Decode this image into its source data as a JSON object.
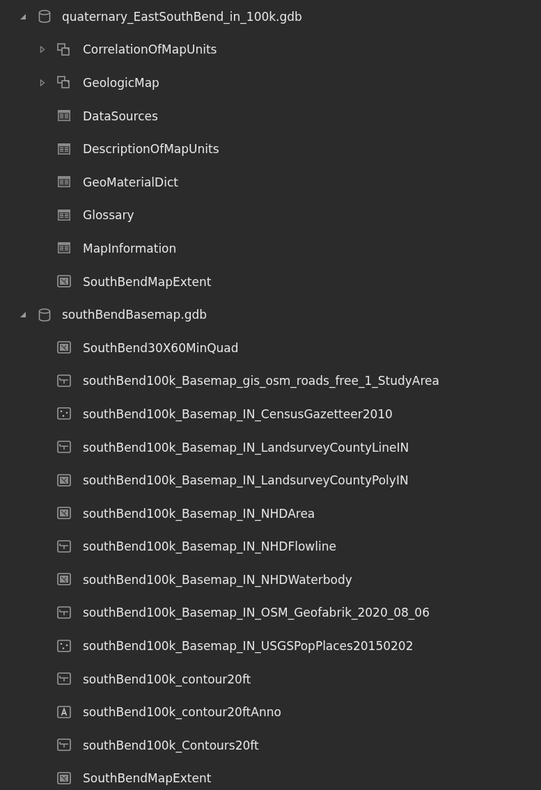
{
  "tree": [
    {
      "label": "quaternary_EastSouthBend_in_100k.gdb",
      "kind": "database",
      "expanded": true,
      "children": [
        {
          "label": "CorrelationOfMapUnits",
          "kind": "dataset",
          "expanded": false
        },
        {
          "label": "GeologicMap",
          "kind": "dataset",
          "expanded": false
        },
        {
          "label": "DataSources",
          "kind": "table"
        },
        {
          "label": "DescriptionOfMapUnits",
          "kind": "table"
        },
        {
          "label": "GeoMaterialDict",
          "kind": "table"
        },
        {
          "label": "Glossary",
          "kind": "table"
        },
        {
          "label": "MapInformation",
          "kind": "table"
        },
        {
          "label": "SouthBendMapExtent",
          "kind": "polygon"
        }
      ]
    },
    {
      "label": "southBendBasemap.gdb",
      "kind": "database",
      "expanded": true,
      "children": [
        {
          "label": "SouthBend30X60MinQuad",
          "kind": "polygon"
        },
        {
          "label": "southBend100k_Basemap_gis_osm_roads_free_1_StudyArea",
          "kind": "line"
        },
        {
          "label": "southBend100k_Basemap_IN_CensusGazetteer2010",
          "kind": "point"
        },
        {
          "label": "southBend100k_Basemap_IN_LandsurveyCountyLineIN",
          "kind": "line"
        },
        {
          "label": "southBend100k_Basemap_IN_LandsurveyCountyPolyIN",
          "kind": "polygon"
        },
        {
          "label": "southBend100k_Basemap_IN_NHDArea",
          "kind": "polygon"
        },
        {
          "label": "southBend100k_Basemap_IN_NHDFlowline",
          "kind": "line"
        },
        {
          "label": "southBend100k_Basemap_IN_NHDWaterbody",
          "kind": "polygon"
        },
        {
          "label": "southBend100k_Basemap_IN_OSM_Geofabrik_2020_08_06",
          "kind": "line"
        },
        {
          "label": "southBend100k_Basemap_IN_USGSPopPlaces20150202",
          "kind": "point"
        },
        {
          "label": "southBend100k_contour20ft",
          "kind": "line"
        },
        {
          "label": "southBend100k_contour20ftAnno",
          "kind": "annotation"
        },
        {
          "label": "southBend100k_Contours20ft",
          "kind": "line"
        },
        {
          "label": "SouthBendMapExtent",
          "kind": "polygon"
        }
      ]
    }
  ]
}
